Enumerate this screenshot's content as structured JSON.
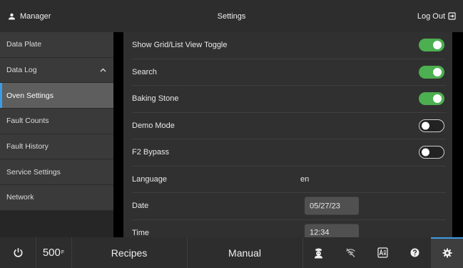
{
  "header": {
    "user_label": "Manager",
    "title": "Settings",
    "logout_label": "Log Out"
  },
  "sidebar": {
    "items": [
      {
        "label": "Data Plate"
      },
      {
        "label": "Data Log"
      },
      {
        "label": "Oven Settings"
      },
      {
        "label": "Fault Counts"
      },
      {
        "label": "Fault History"
      },
      {
        "label": "Service Settings"
      },
      {
        "label": "Network"
      }
    ],
    "active_index": 2
  },
  "settings": {
    "rows": [
      {
        "label": "Show Grid/List View Toggle",
        "toggle": true
      },
      {
        "label": "Search",
        "toggle": true
      },
      {
        "label": "Baking Stone",
        "toggle": true
      },
      {
        "label": "Demo Mode",
        "toggle": false
      },
      {
        "label": "F2 Bypass",
        "toggle": false
      },
      {
        "label": "Language",
        "value": "en"
      },
      {
        "label": "Date",
        "value": "05/27/23"
      },
      {
        "label": "Time",
        "value": "12:34"
      }
    ]
  },
  "bottom_bar": {
    "temperature": "500",
    "temperature_unit": "F",
    "recipes_label": "Recipes",
    "manual_label": "Manual"
  },
  "colors": {
    "toggle_on": "#4caf50",
    "accent": "#3b9ce6"
  }
}
